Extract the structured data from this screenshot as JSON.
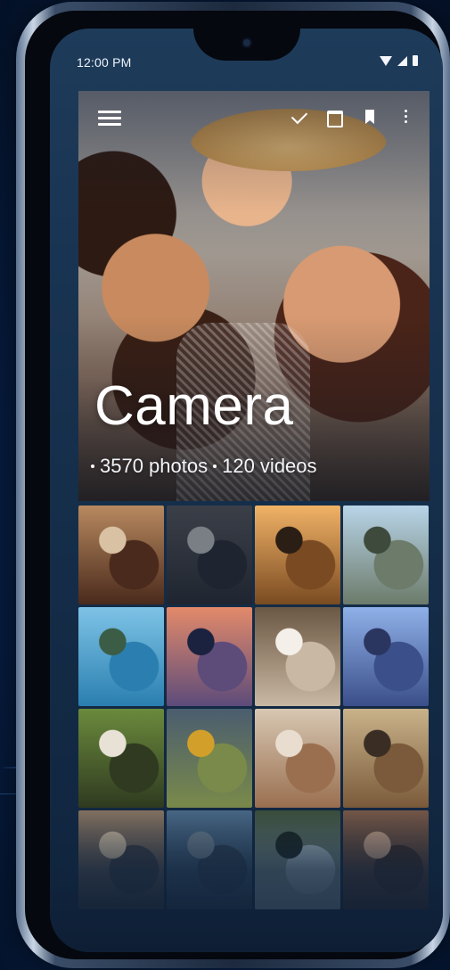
{
  "status_bar": {
    "time": "12:00 PM",
    "icons": [
      "wifi-icon",
      "signal-icon",
      "battery-icon"
    ]
  },
  "toolbar": {
    "menu_icon": "menu-icon",
    "actions": [
      "check-icon",
      "calendar-icon",
      "bookmark-icon",
      "more-vert-icon"
    ]
  },
  "album": {
    "title": "Camera",
    "photos_count": "3570 photos",
    "videos_count": "120 videos"
  },
  "grid": {
    "thumbnails": [
      {
        "name": "friends-selfie-thumbnail",
        "colors": [
          "#b7895f",
          "#4a2a1c",
          "#d9c2a3"
        ]
      },
      {
        "name": "basketball-dunk-thumbnail",
        "colors": [
          "#3b3f48",
          "#1f2530",
          "#7a7f86"
        ]
      },
      {
        "name": "sunset-couple-thumbnail",
        "colors": [
          "#f0b266",
          "#7a4b22",
          "#2b1e14"
        ]
      },
      {
        "name": "mountain-hikers-thumbnail",
        "colors": [
          "#b8d4e8",
          "#6c7b6a",
          "#3d4a3c"
        ]
      },
      {
        "name": "cliff-jumpers-thumbnail",
        "colors": [
          "#7ec3e6",
          "#2a7fb0",
          "#3b5d46"
        ]
      },
      {
        "name": "city-sunset-thumbnail",
        "colors": [
          "#e38a6a",
          "#5d4b7a",
          "#1b2240"
        ]
      },
      {
        "name": "cherry-blossom-thumbnail",
        "colors": [
          "#6b5844",
          "#c9b8a3",
          "#f4efe8"
        ]
      },
      {
        "name": "city-skyline-thumbnail",
        "colors": [
          "#8fb0e8",
          "#3b4f8a",
          "#2a3560"
        ]
      },
      {
        "name": "woman-portrait-thumbnail",
        "colors": [
          "#6b8a3c",
          "#2f3a20",
          "#e8e2d6"
        ]
      },
      {
        "name": "rainbow-meadow-thumbnail",
        "colors": [
          "#4a5d6f",
          "#7a8a4a",
          "#d2a02a"
        ]
      },
      {
        "name": "friends-fair-thumbnail",
        "colors": [
          "#d7c7b2",
          "#9a6f50",
          "#e9ddd0"
        ]
      },
      {
        "name": "couple-walking-thumbnail",
        "colors": [
          "#c9b28a",
          "#7a5a3a",
          "#3a2e24"
        ]
      },
      {
        "name": "woman-hat-thumbnail",
        "colors": [
          "#8a7662",
          "#3a3a40",
          "#c7b49a"
        ]
      },
      {
        "name": "coastal-cliffs-thumbnail",
        "colors": [
          "#4b6b8a",
          "#2c3e50",
          "#6a7c8a"
        ]
      },
      {
        "name": "waterfall-thumbnail",
        "colors": [
          "#3c4f3a",
          "#9fb0b8",
          "#1c2620"
        ]
      },
      {
        "name": "friends-hug-thumbnail",
        "colors": [
          "#7a5a48",
          "#3a2a24",
          "#c09a80"
        ]
      }
    ]
  },
  "colors": {
    "background": "#061b3d",
    "screen": "#16304d",
    "text": "#ffffff"
  }
}
